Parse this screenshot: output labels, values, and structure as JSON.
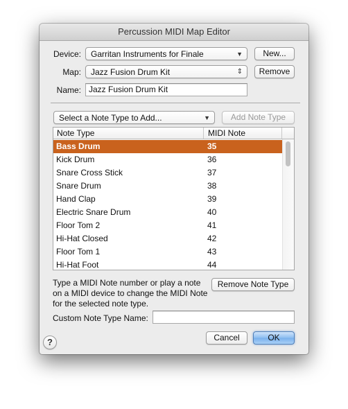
{
  "window": {
    "title": "Percussion MIDI Map Editor"
  },
  "device": {
    "label": "Device:",
    "value": "Garritan Instruments for Finale",
    "arrow": "▼",
    "new_button": "New..."
  },
  "map": {
    "label": "Map:",
    "value": "Jazz Fusion Drum Kit",
    "arrow": "⇕",
    "remove_button": "Remove"
  },
  "name": {
    "label": "Name:",
    "value": "Jazz Fusion Drum Kit"
  },
  "note_type_select": {
    "value": "Select a Note Type to Add...",
    "arrow": "▼",
    "add_button": "Add Note Type"
  },
  "table": {
    "columns": [
      "Note Type",
      "MIDI Note"
    ],
    "selected_color": "#c9621d",
    "rows": [
      {
        "name": "Bass Drum",
        "note": "35",
        "selected": true
      },
      {
        "name": "Kick Drum",
        "note": "36"
      },
      {
        "name": "Snare Cross Stick",
        "note": "37"
      },
      {
        "name": "Snare Drum",
        "note": "38"
      },
      {
        "name": "Hand Clap",
        "note": "39"
      },
      {
        "name": "Electric Snare Drum",
        "note": "40"
      },
      {
        "name": "Floor Tom 2",
        "note": "41"
      },
      {
        "name": "Hi-Hat Closed",
        "note": "42"
      },
      {
        "name": "Floor Tom 1",
        "note": "43"
      },
      {
        "name": "Hi-Hat Foot",
        "note": "44"
      }
    ]
  },
  "info_text": "Type a MIDI Note number or play a note on a MIDI device to change the MIDI Note for the selected note type.",
  "remove_note_type_button": "Remove Note Type",
  "custom_name": {
    "label": "Custom Note Type Name:",
    "value": ""
  },
  "footer": {
    "help": "?",
    "cancel": "Cancel",
    "ok": "OK"
  }
}
